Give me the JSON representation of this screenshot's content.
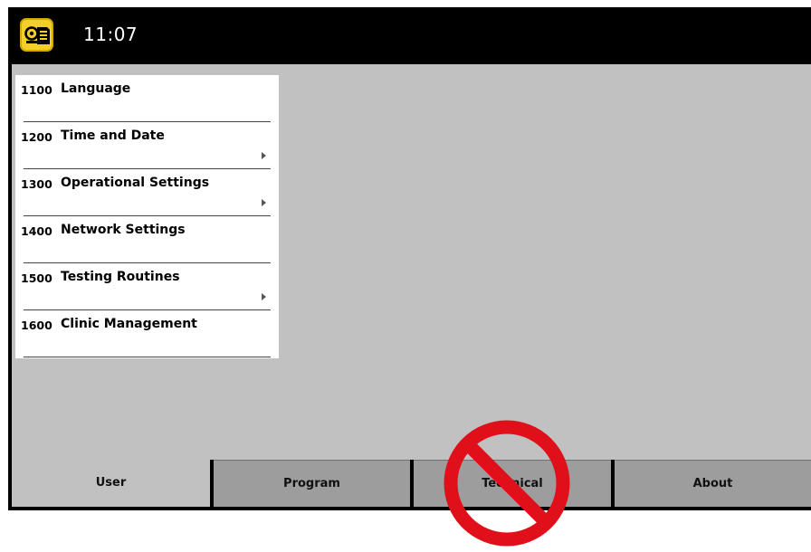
{
  "header": {
    "time": "11:07",
    "app_icon": "manual-book-icon",
    "accent_color": "#f2cf2a"
  },
  "menu": {
    "items": [
      {
        "code": "1100",
        "label": "Language",
        "has_submenu": false
      },
      {
        "code": "1200",
        "label": "Time and Date",
        "has_submenu": true
      },
      {
        "code": "1300",
        "label": "Operational Settings",
        "has_submenu": true
      },
      {
        "code": "1400",
        "label": "Network Settings",
        "has_submenu": false
      },
      {
        "code": "1500",
        "label": "Testing Routines",
        "has_submenu": true
      },
      {
        "code": "1600",
        "label": "Clinic Management",
        "has_submenu": false
      }
    ]
  },
  "tabs": {
    "items": [
      {
        "label": "User",
        "active": true
      },
      {
        "label": "Program",
        "active": false
      },
      {
        "label": "Technical",
        "active": false
      },
      {
        "label": "About",
        "active": false
      }
    ]
  },
  "overlay": {
    "icon": "prohibited-icon",
    "color": "#e0101a"
  }
}
